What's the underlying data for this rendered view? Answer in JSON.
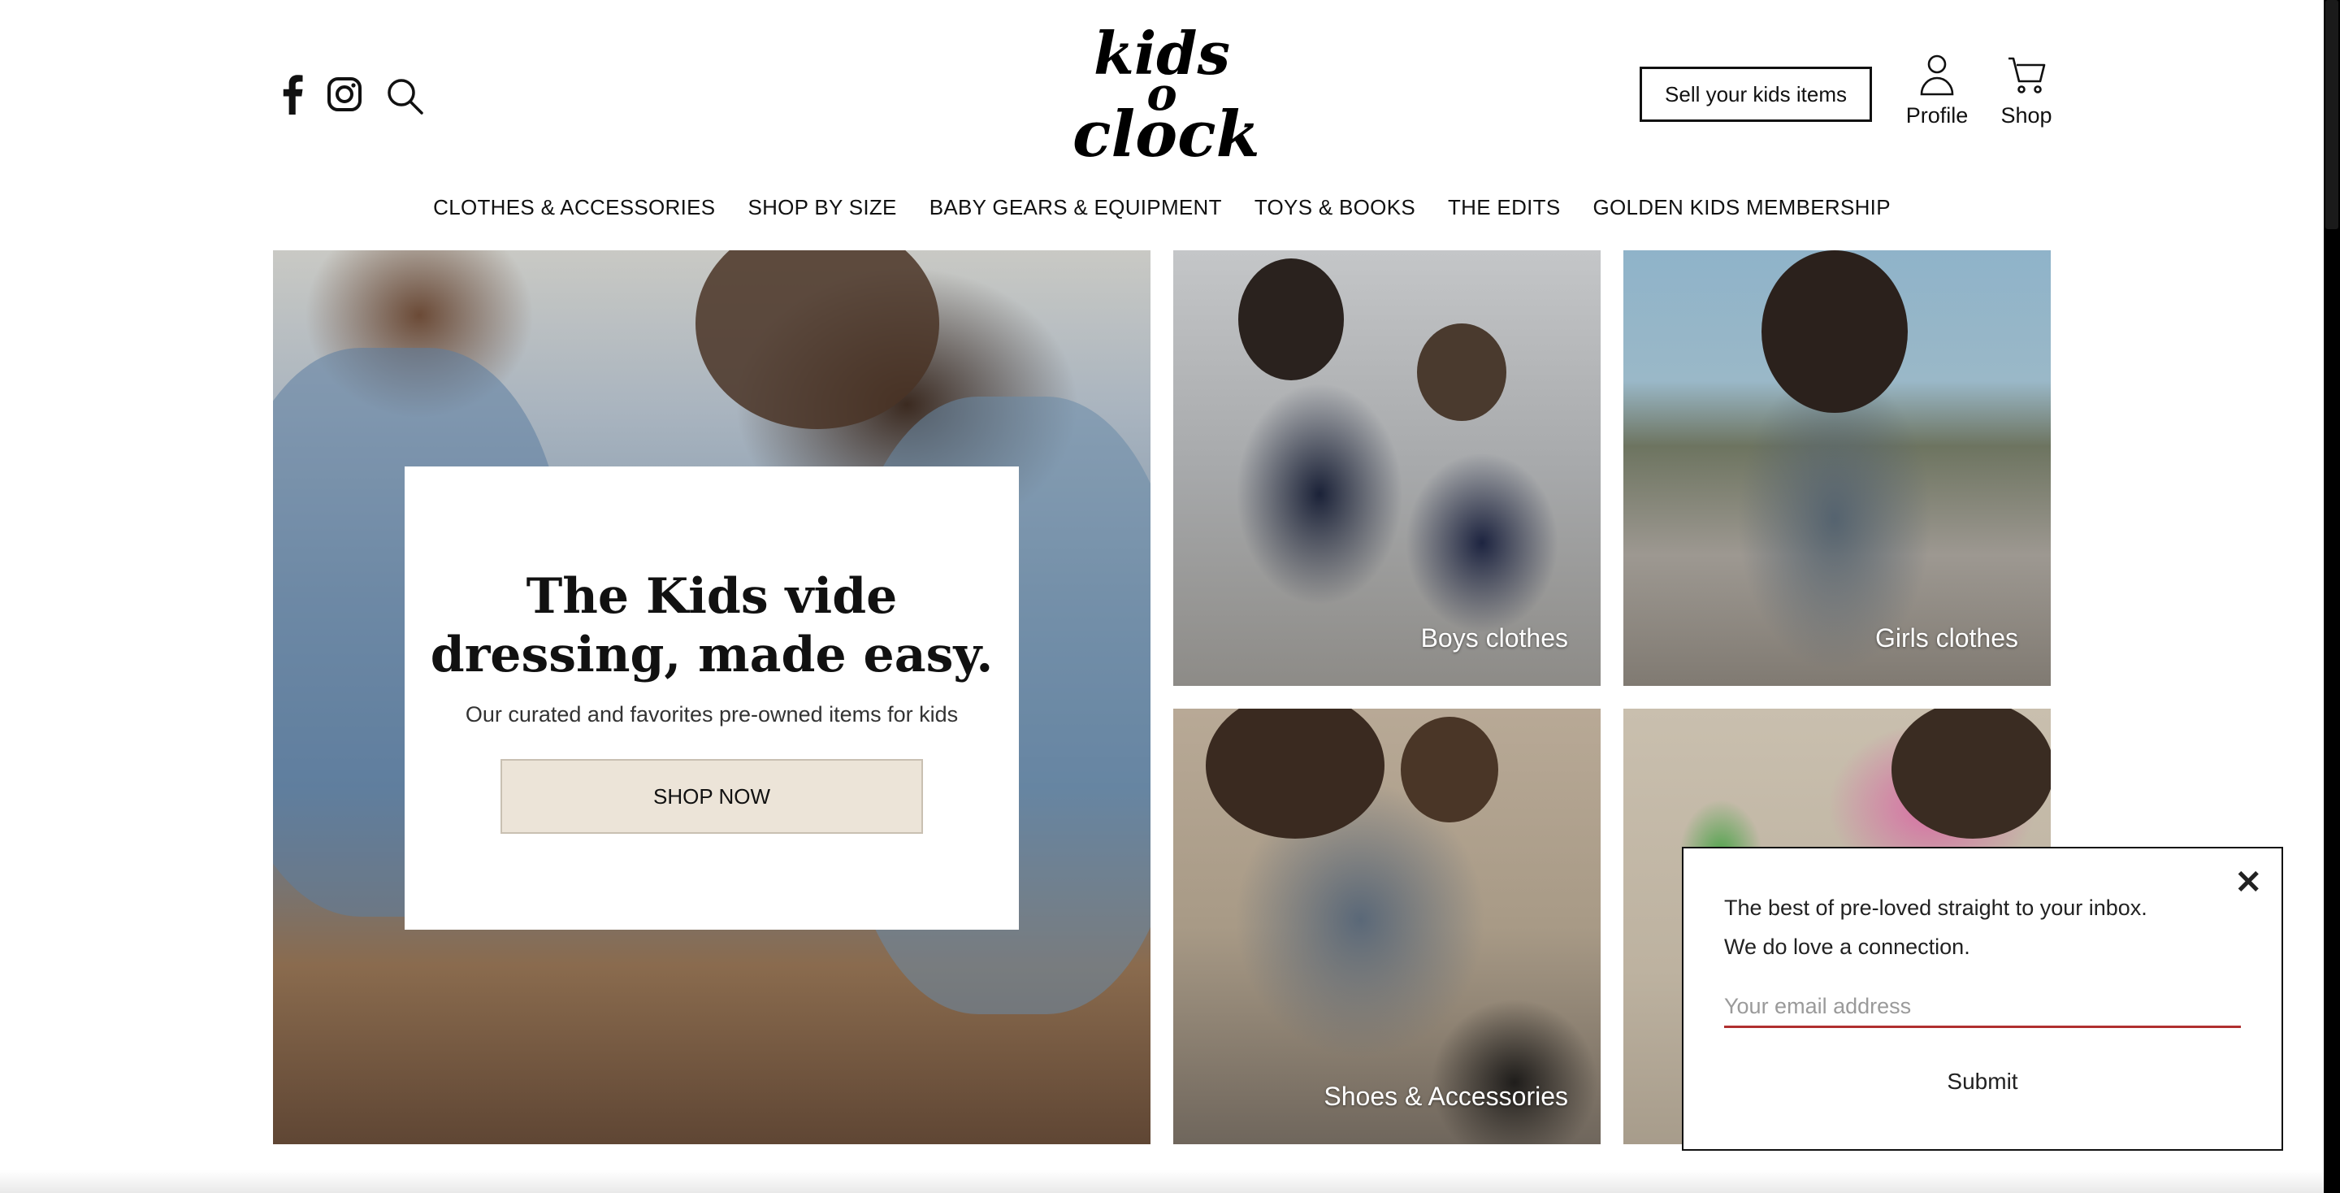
{
  "header": {
    "social_icons": [
      "facebook-icon",
      "instagram-icon"
    ],
    "search_icon": "search-icon",
    "logo_lines": [
      "kids",
      "o",
      "clock"
    ],
    "sell_button": "Sell your kids items",
    "profile_label": "Profile",
    "shop_label": "Shop"
  },
  "nav": {
    "items": [
      {
        "label": "CLOTHES & ACCESSORIES"
      },
      {
        "label": "SHOP BY SIZE"
      },
      {
        "label": "BABY GEARS & EQUIPMENT"
      },
      {
        "label": "TOYS & BOOKS"
      },
      {
        "label": "THE EDITS"
      },
      {
        "label": "GOLDEN KIDS MEMBERSHIP"
      }
    ]
  },
  "hero": {
    "title_line1": "The Kids vide",
    "title_line2": "dressing, made easy.",
    "subtitle": "Our curated and favorites pre-owned items for kids",
    "cta": "SHOP NOW"
  },
  "tiles": [
    {
      "label": "Boys clothes"
    },
    {
      "label": "Girls clothes"
    },
    {
      "label": "Shoes & Accessories"
    },
    {
      "label": ""
    }
  ],
  "newsletter": {
    "line1": "The best of pre-loved straight to your inbox.",
    "line2": "We do love a connection.",
    "email_placeholder": "Your email address",
    "submit": "Submit",
    "accent_color": "#b03030"
  }
}
